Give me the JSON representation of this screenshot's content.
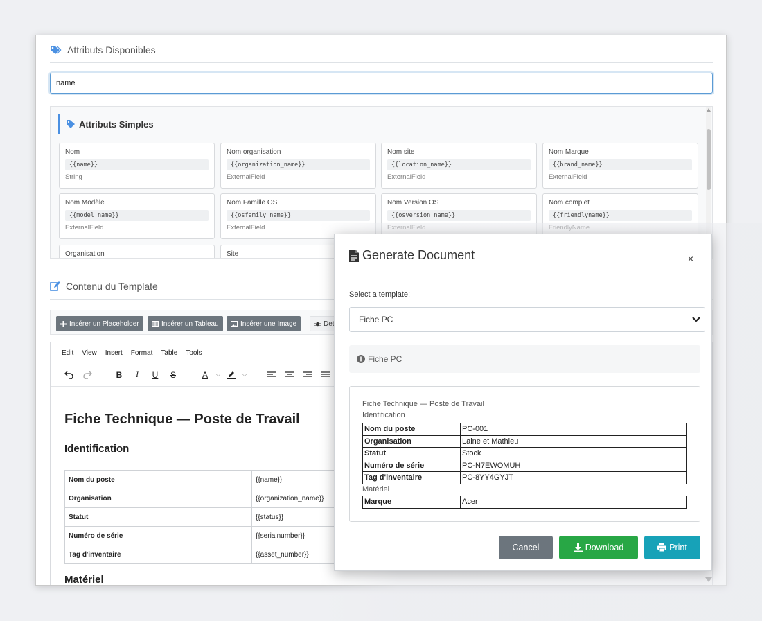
{
  "attributes": {
    "header": "Attributs Disponibles",
    "search_value": "name",
    "group_title": "Attributs Simples",
    "cards": [
      {
        "name": "Nom",
        "code": "{{name}}",
        "type": "String"
      },
      {
        "name": "Nom organisation",
        "code": "{{organization_name}}",
        "type": "ExternalField"
      },
      {
        "name": "Nom site",
        "code": "{{location_name}}",
        "type": "ExternalField"
      },
      {
        "name": "Nom Marque",
        "code": "{{brand_name}}",
        "type": "ExternalField"
      },
      {
        "name": "Nom Modèle",
        "code": "{{model_name}}",
        "type": "ExternalField"
      },
      {
        "name": "Nom Famille OS",
        "code": "{{osfamily_name}}",
        "type": "ExternalField"
      },
      {
        "name": "Nom Version OS",
        "code": "{{osversion_name}}",
        "type": "ExternalField"
      },
      {
        "name": "Nom complet",
        "code": "{{friendlyname}}",
        "type": "FriendlyName"
      },
      {
        "name": "Organisation",
        "code": "",
        "type": ""
      },
      {
        "name": "Site",
        "code": "",
        "type": ""
      }
    ]
  },
  "template": {
    "header": "Contenu du Template",
    "buttons": {
      "placeholder": "Insérer un Placeholder",
      "table": "Insérer un Tableau",
      "image": "Insérer une Image",
      "debug": "Det"
    },
    "menu": [
      "Edit",
      "View",
      "Insert",
      "Format",
      "Table",
      "Tools"
    ],
    "doc_title": "Fiche Technique — Poste de Travail",
    "section1": "Identification",
    "rows": [
      {
        "k": "Nom du poste",
        "v": "{{name}}"
      },
      {
        "k": "Organisation",
        "v": "{{organization_name}}"
      },
      {
        "k": "Statut",
        "v": "{{status}}"
      },
      {
        "k": "Numéro de série",
        "v": "{{serialnumber}}"
      },
      {
        "k": "Tag d'inventaire",
        "v": "{{asset_number}}"
      }
    ],
    "section2": "Matériel"
  },
  "modal": {
    "title": "Generate Document",
    "close": "×",
    "select_label": "Select a template:",
    "selected_template": "Fiche PC",
    "info_text": "Fiche PC",
    "preview": {
      "title": "Fiche Technique — Poste de Travail",
      "section1": "Identification",
      "rows": [
        {
          "k": "Nom du poste",
          "v": "PC-001"
        },
        {
          "k": "Organisation",
          "v": "Laine et Mathieu"
        },
        {
          "k": "Statut",
          "v": "Stock"
        },
        {
          "k": "Numéro de série",
          "v": "PC-N7EWOMUH"
        },
        {
          "k": "Tag d'inventaire",
          "v": "PC-8YY4GYJT"
        }
      ],
      "section2": "Matériel",
      "rows2": [
        {
          "k": "Marque",
          "v": "Acer"
        }
      ]
    },
    "buttons": {
      "cancel": "Cancel",
      "download": "Download",
      "print": "Print"
    },
    "colors": {
      "cancel": "#6c757d",
      "download": "#28a745",
      "print": "#17a2b8"
    }
  }
}
